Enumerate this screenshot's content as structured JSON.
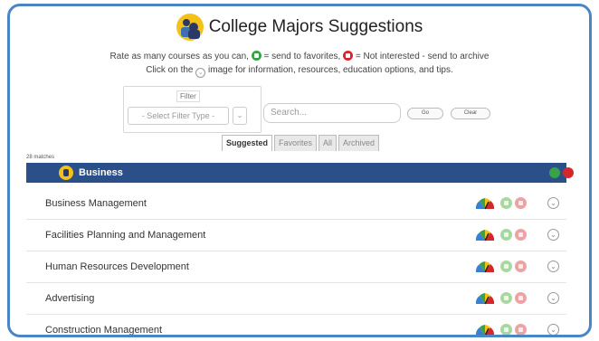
{
  "app": {
    "title": "College Majors Suggestions",
    "logo_icon": "college-majors-logo"
  },
  "instructions": {
    "line1_a": "Rate as many courses as you can,",
    "line1_b": "= send to favorites,",
    "line1_c": "= Not interested - send to archive",
    "line2_a": "Click on the",
    "line2_b": "image for information, resources, education options, and tips.",
    "favorite_icon": "green-favorite-icon",
    "archive_icon": "red-archive-icon",
    "info_icon": "chevron-down-circle-icon"
  },
  "filter": {
    "label": "Filter",
    "select_value": "- Select Filter Type -",
    "select_arrow": "⌄"
  },
  "search": {
    "placeholder": "Search...",
    "go_label": "Go",
    "clear_label": "Clear"
  },
  "tabs": [
    {
      "label": "Suggested",
      "active": true
    },
    {
      "label": "Favorites",
      "active": false
    },
    {
      "label": "All",
      "active": false
    },
    {
      "label": "Archived",
      "active": false
    }
  ],
  "results": {
    "count_text": "28 matches"
  },
  "category": {
    "name": "Business",
    "icon": "business-icon"
  },
  "majors": [
    {
      "name": "Business Management"
    },
    {
      "name": "Facilities Planning and Management"
    },
    {
      "name": "Human Resources Development"
    },
    {
      "name": "Advertising"
    },
    {
      "name": "Construction Management"
    }
  ],
  "row_icons": {
    "gauge": "rating-gauge-icon",
    "favorite": "favorite-icon",
    "archive": "archive-icon",
    "info": "chevron-down-icon",
    "info_glyph": "⌄"
  },
  "colors": {
    "frame_border": "#4a86c5",
    "category_bar": "#2b4f88",
    "favorite_green": "#3aa14a",
    "archive_red": "#d7262b",
    "logo_yellow": "#f2c21a"
  }
}
